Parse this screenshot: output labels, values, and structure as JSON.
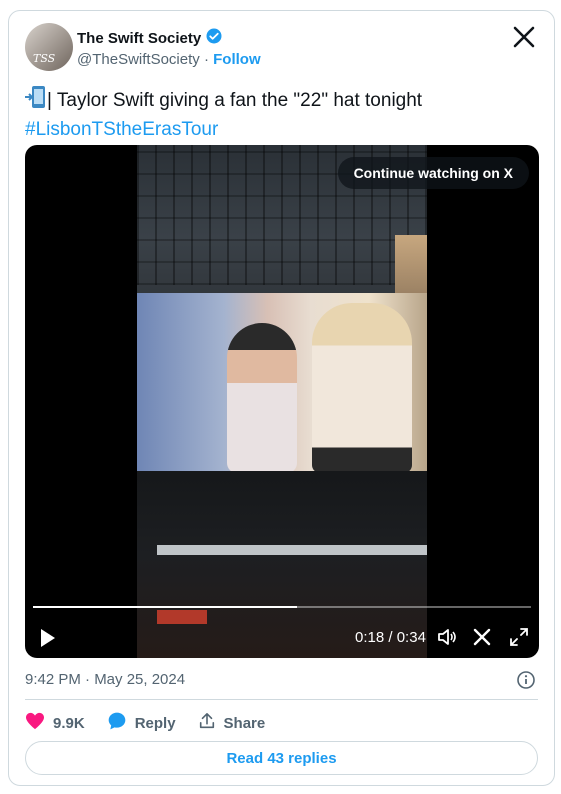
{
  "author": {
    "display_name": "The Swift Society",
    "handle": "@TheSwiftSociety",
    "separator": " · ",
    "follow_label": "Follow",
    "avatar_text": "TSS",
    "verified": true
  },
  "tweet": {
    "text": "| Taylor Swift giving a fan the \"22\" hat tonight",
    "hashtag": "#LisbonTStheErasTour",
    "timestamp": "9:42 PM · May 25, 2024"
  },
  "video": {
    "cta_label": "Continue watching on X",
    "time_current": "0:18",
    "time_total": "0:34",
    "time_separator": " / ",
    "progress": 0.53
  },
  "actions": {
    "likes": "9.9K",
    "reply_label": "Reply",
    "share_label": "Share",
    "read_replies_label": "Read 43 replies"
  },
  "colors": {
    "accent": "#1d9bf0",
    "like": "#f91880",
    "text": "#0f1419",
    "muted": "#536471",
    "border": "#cfd9de"
  }
}
